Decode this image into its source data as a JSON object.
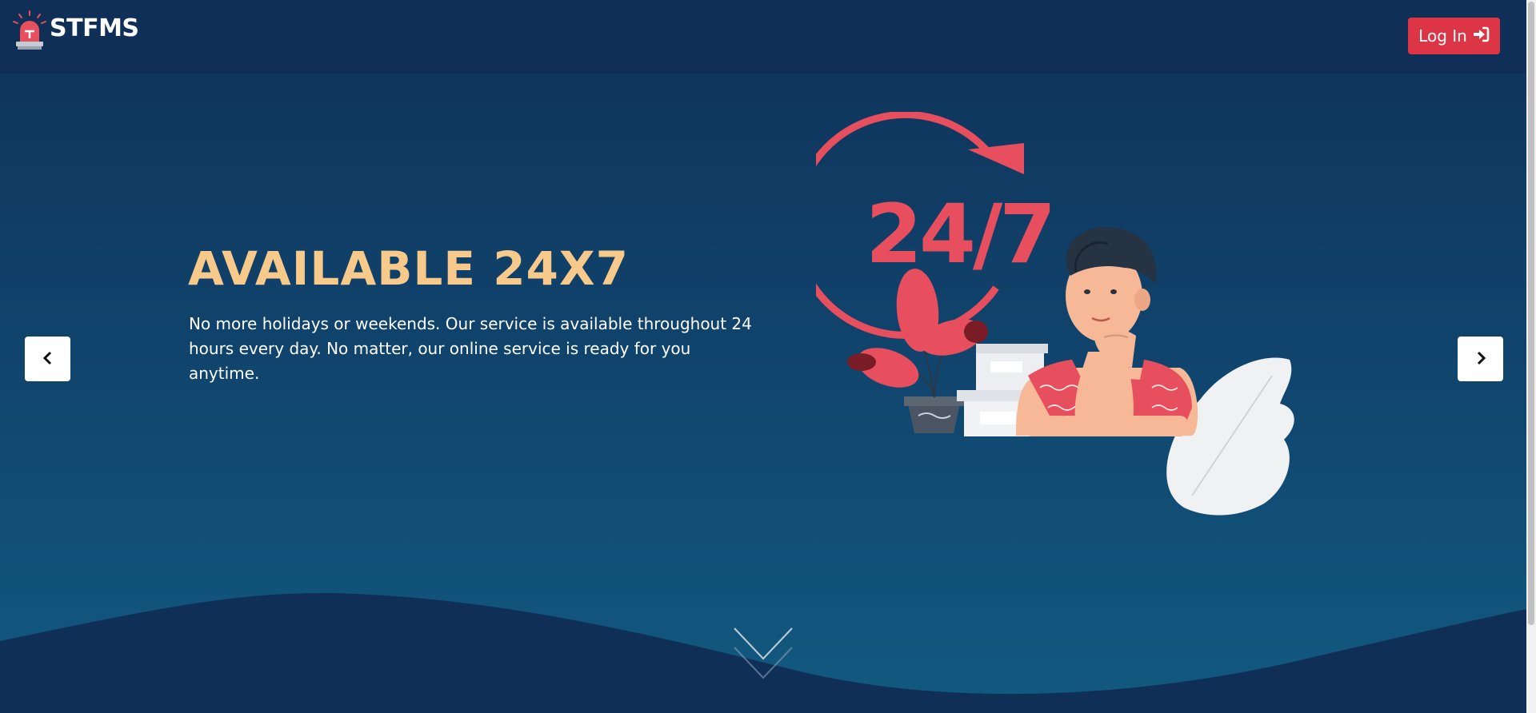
{
  "header": {
    "brand_name": "STFMS",
    "login_label": "Log In"
  },
  "slide": {
    "title": "AVAILABLE 24X7",
    "text": "No more holidays or weekends. Our service is available throughout 24 hours every day. No matter, our online service is ready for you anytime.",
    "illustration_text": "24/7"
  },
  "icons": {
    "logo": "alarm-light-icon",
    "login": "sign-in-icon",
    "prev": "chevron-left-icon",
    "next": "chevron-right-icon",
    "scroll": "chevron-down-icon"
  },
  "colors": {
    "navbar": "#0f2f57",
    "accent": "#dc3545",
    "title": "#f7c98a",
    "illustration_red": "#e84f5e"
  }
}
